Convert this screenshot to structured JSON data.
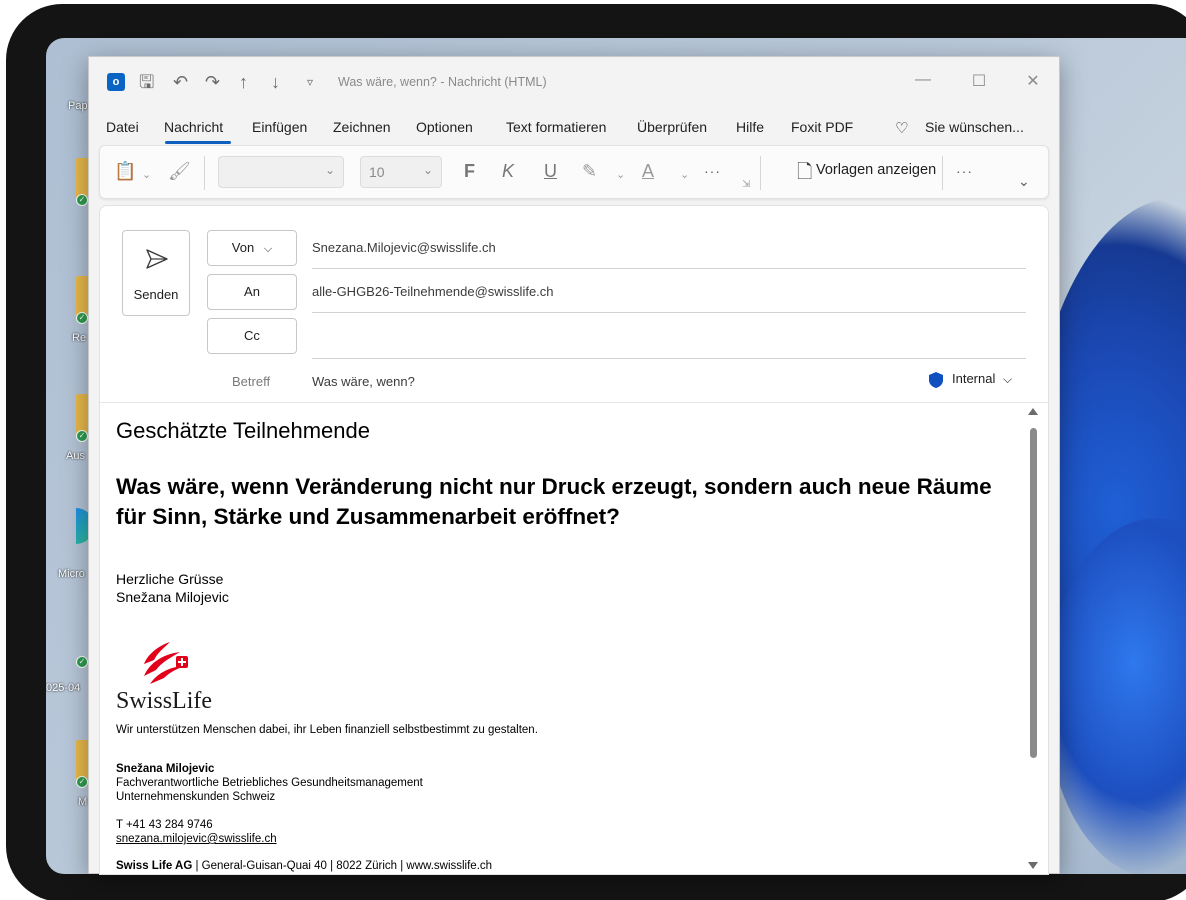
{
  "desktop": {
    "labels": [
      "Pap",
      "Re",
      "Aus",
      "Micro",
      "025-04",
      "M"
    ]
  },
  "titlebar": {
    "title": "Was wäre, wenn?  -  Nachricht (HTML)",
    "minimize": "—",
    "maximize": "☐",
    "close": "✕"
  },
  "menu": {
    "items": [
      "Datei",
      "Nachricht",
      "Einfügen",
      "Zeichnen",
      "Optionen",
      "Text formatieren",
      "Überprüfen",
      "Hilfe",
      "Foxit PDF"
    ],
    "active": "Nachricht",
    "search": "Sie wünschen..."
  },
  "ribbon": {
    "font_size": "10",
    "bold": "F",
    "italic": "K",
    "underline": "U",
    "more": "···",
    "templates": "Vorlagen anzeigen",
    "overflow": "···"
  },
  "compose": {
    "send_label": "Senden",
    "from_label": "Von",
    "to_label": "An",
    "cc_label": "Cc",
    "subject_label": "Betreff",
    "from_value": "Snezana.Milojevic@swisslife.ch",
    "to_value": "alle-GHGB26-Teilnehmende@swisslife.ch",
    "cc_value": "",
    "subject_value": "Was wäre, wenn?",
    "sensitivity": "Internal"
  },
  "body": {
    "greeting": "Geschätzte Teilnehmende",
    "headline": "Was wäre, wenn Veränderung nicht nur Druck erzeugt, sondern auch neue Räume für Sinn, Stärke und Zusammenarbeit eröffnet?",
    "closing_1": "Herzliche Grüsse",
    "closing_2": "Snežana Milojevic",
    "logo_word": "SwissLife",
    "tagline": "Wir unterstützen Menschen dabei, ihr Leben finanziell selbstbestimmt zu gestalten.",
    "sig_name": "Snežana Milojevic",
    "sig_title": "Fachverantwortliche Betriebliches Gesundheitsmanagement",
    "sig_dept": "Unternehmenskunden Schweiz",
    "phone": "T  +41 43 284 9746",
    "email": "snezana.milojevic@swisslife.ch",
    "company_name": "Swiss Life AG",
    "company_rest": " | General-Guisan-Quai 40 | 8022 Zürich | www.swisslife.ch"
  },
  "colors": {
    "accent": "#0f5fbe",
    "logo_red": "#e2001a"
  }
}
